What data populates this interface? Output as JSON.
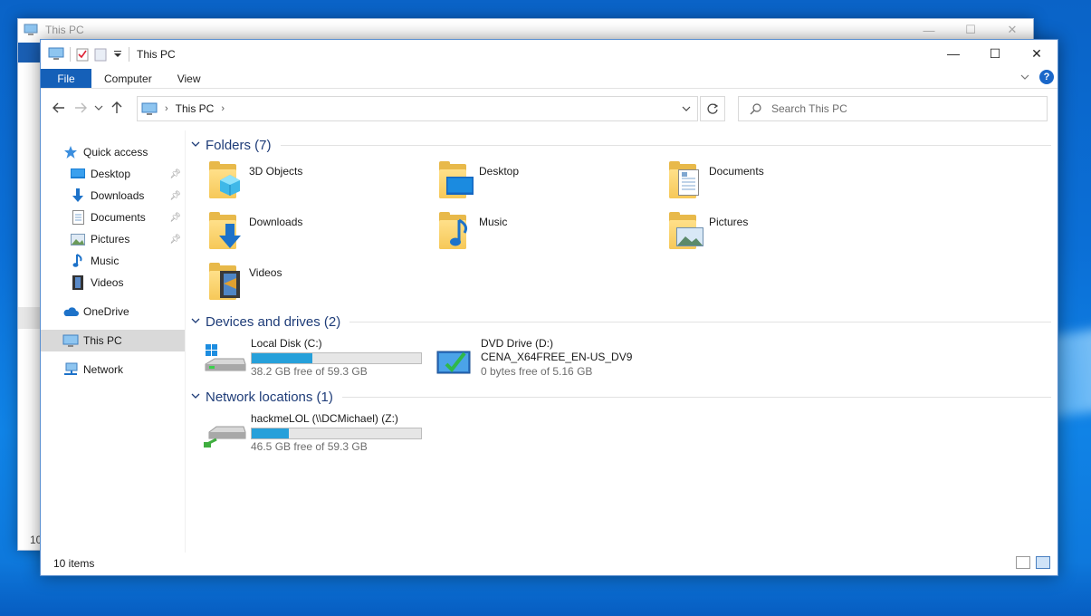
{
  "background_window": {
    "title": "This PC",
    "item_count_partial": "10"
  },
  "window": {
    "title": "This PC",
    "controls": {
      "minimize": "—",
      "maximize": "☐",
      "close": "✕"
    }
  },
  "ribbon": {
    "tabs": [
      {
        "label": "File",
        "active": true
      },
      {
        "label": "Computer"
      },
      {
        "label": "View"
      }
    ],
    "help_label": "?"
  },
  "address_bar": {
    "location": "This PC",
    "search_placeholder": "Search This PC"
  },
  "nav_pane": {
    "quick_access": "Quick access",
    "quick_items": [
      {
        "label": "Desktop",
        "pinned": true
      },
      {
        "label": "Downloads",
        "pinned": true
      },
      {
        "label": "Documents",
        "pinned": true
      },
      {
        "label": "Pictures",
        "pinned": true
      },
      {
        "label": "Music",
        "pinned": false
      },
      {
        "label": "Videos",
        "pinned": false
      }
    ],
    "onedrive": "OneDrive",
    "this_pc": "This PC",
    "network": "Network"
  },
  "groups": {
    "folders": {
      "header": "Folders (7)",
      "items": [
        "3D Objects",
        "Desktop",
        "Documents",
        "Downloads",
        "Music",
        "Pictures",
        "Videos"
      ]
    },
    "devices": {
      "header": "Devices and drives (2)",
      "items": [
        {
          "name": "Local Disk (C:)",
          "free": "38.2 GB free of 59.3 GB",
          "used_fraction": 0.36
        },
        {
          "name": "DVD Drive (D:)",
          "label": "CENA_X64FREE_EN-US_DV9",
          "free": "0 bytes free of 5.16 GB"
        }
      ]
    },
    "network": {
      "header": "Network locations (1)",
      "items": [
        {
          "name": "hackmeLOL (\\\\DCMichael) (Z:)",
          "free": "46.5 GB free of 59.3 GB",
          "used_fraction": 0.22
        }
      ]
    }
  },
  "status_bar": {
    "count": "10 items"
  },
  "colors": {
    "accent": "#1560b8",
    "bar_fill": "#26a0da",
    "group_header": "#1e3c78"
  }
}
